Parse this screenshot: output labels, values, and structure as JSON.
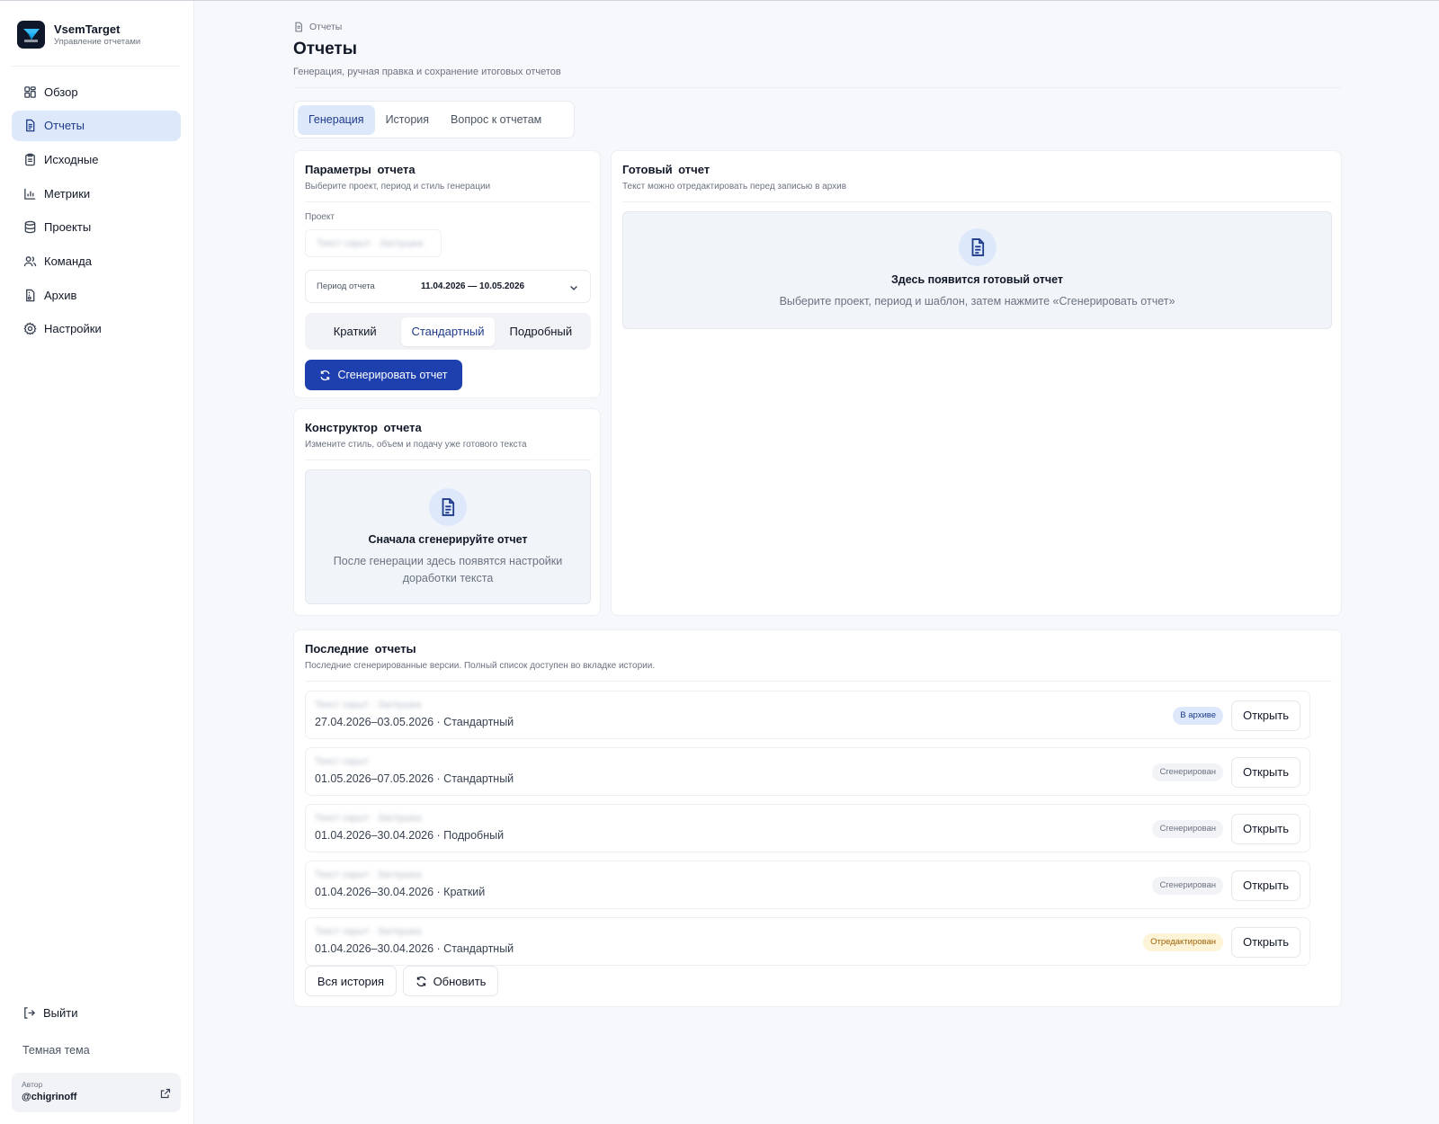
{
  "app": {
    "name": "VsemTarget",
    "subtitle": "Управление отчетами"
  },
  "sidebar": {
    "items": [
      {
        "label": "Обзор",
        "icon": "grid-icon",
        "active": false
      },
      {
        "label": "Отчеты",
        "icon": "document-icon",
        "active": true
      },
      {
        "label": "Исходные",
        "icon": "clipboard-icon",
        "active": false
      },
      {
        "label": "Метрики",
        "icon": "bar-chart-icon",
        "active": false
      },
      {
        "label": "Проекты",
        "icon": "database-icon",
        "active": false
      },
      {
        "label": "Команда",
        "icon": "users-icon",
        "active": false
      },
      {
        "label": "Архив",
        "icon": "archive-file-icon",
        "active": false
      },
      {
        "label": "Настройки",
        "icon": "gear-icon",
        "active": false
      }
    ],
    "logout": "Выйти",
    "theme_toggle": "Темная тема",
    "author_caption": "Автор",
    "author_name": "@chigrinoff"
  },
  "header": {
    "breadcrumb": "Отчеты",
    "title": "Отчеты",
    "subtitle": "Генерация, ручная правка и сохранение итоговых отчетов"
  },
  "tabs": [
    {
      "label": "Генерация",
      "active": true
    },
    {
      "label": "История",
      "active": false
    },
    {
      "label": "Вопрос к отчетам",
      "active": false
    }
  ],
  "params": {
    "title": "Параметры отчета",
    "subtitle": "Выберите проект, период и стиль генерации",
    "project_label": "Проект",
    "project_value": "Текст скрыт · Заглушка",
    "period_label": "Период отчета",
    "period_value": "11.04.2026 — 10.05.2026",
    "styles": [
      {
        "label": "Краткий",
        "active": false
      },
      {
        "label": "Стандартный",
        "active": true
      },
      {
        "label": "Подробный",
        "active": false
      }
    ],
    "generate_label": "Сгенерировать отчет"
  },
  "builder": {
    "title": "Конструктор отчета",
    "subtitle": "Измените стиль, объем и подачу уже готового текста",
    "empty_title": "Сначала сгенерируйте отчет",
    "empty_text": "После генерации здесь появятся настройки доработки текста"
  },
  "ready": {
    "title": "Готовый отчет",
    "subtitle": "Текст можно отредактировать перед записью в архив",
    "empty_title": "Здесь появится готовый отчет",
    "empty_text": "Выберите проект, период и шаблон, затем нажмите «Сгенерировать отчет»"
  },
  "recent": {
    "title": "Последние отчеты",
    "subtitle": "Последние сгенерированные версии. Полный список доступен во вкладке истории.",
    "rows": [
      {
        "name": "Текст скрыт · Заглушка",
        "meta": "27.04.2026–03.05.2026 · Стандартный",
        "status": "В архиве",
        "status_kind": "archived",
        "action": "Открыть"
      },
      {
        "name": "Текст скрыт",
        "meta": "01.05.2026–07.05.2026 · Стандартный",
        "status": "Сгенерирован",
        "status_kind": "generated",
        "action": "Открыть"
      },
      {
        "name": "Текст скрыт · Заглушка",
        "meta": "01.04.2026–30.04.2026 · Подробный",
        "status": "Сгенерирован",
        "status_kind": "generated",
        "action": "Открыть"
      },
      {
        "name": "Текст скрыт · Заглушка",
        "meta": "01.04.2026–30.04.2026 · Краткий",
        "status": "Сгенерирован",
        "status_kind": "generated",
        "action": "Открыть"
      },
      {
        "name": "Текст скрыт · Заглушка",
        "meta": "01.04.2026–30.04.2026 · Стандартный",
        "status": "Отредактирован",
        "status_kind": "edited",
        "action": "Открыть"
      }
    ],
    "all_history_label": "Вся история",
    "refresh_label": "Обновить"
  },
  "colors": {
    "accent": "#1e40af",
    "active_bg": "#dde9fb",
    "edited_badge": "#fdf3d7"
  }
}
